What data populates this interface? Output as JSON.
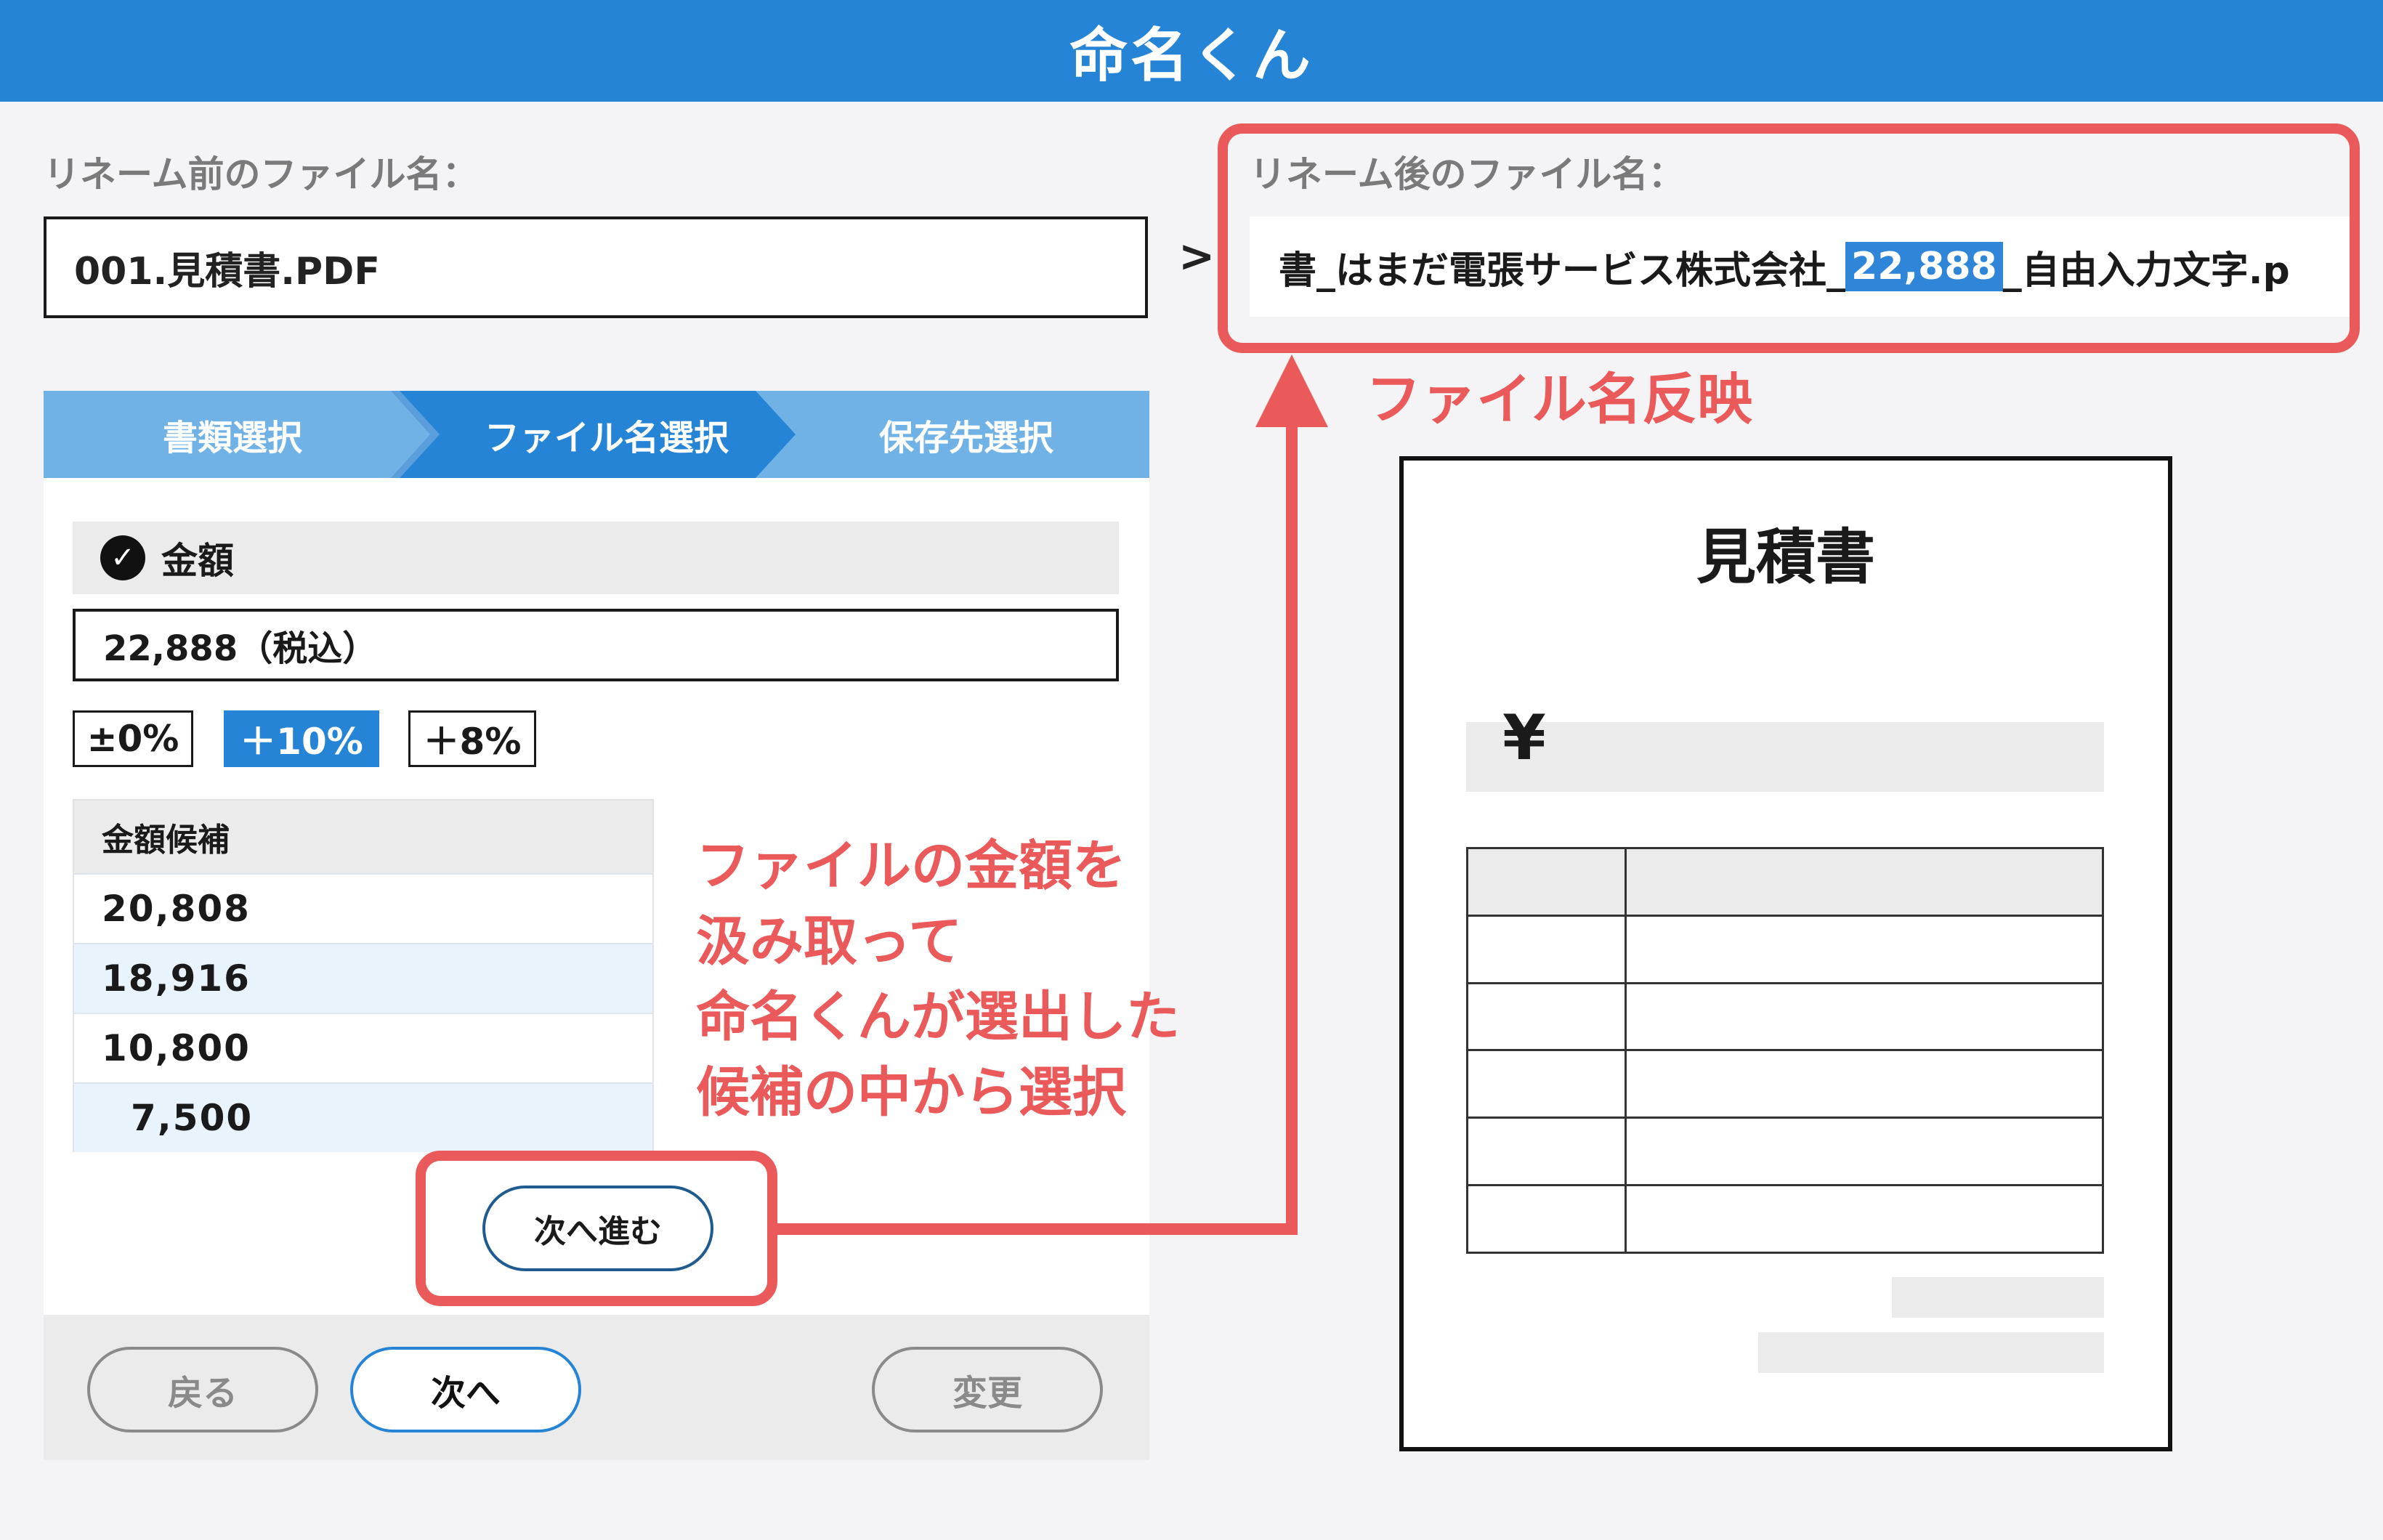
{
  "app": {
    "title": "命名くん"
  },
  "before": {
    "label": "リネーム前のファイル名：",
    "value": "001.見積書.PDF"
  },
  "arrow": ">",
  "after": {
    "label": "リネーム後のファイル名：",
    "prefix": "書_はまだ電張サービス株式会社_",
    "highlight": "22,888",
    "suffix": "_自由入力文字.p"
  },
  "steps": [
    "書類選択",
    "ファイル名選択",
    "保存先選択"
  ],
  "amount": {
    "heading": "金額",
    "value": "22,888（税込）",
    "tax_buttons": [
      "±0%",
      "＋10%",
      "＋8%"
    ],
    "candidates_heading": "金額候補",
    "candidates": [
      "20,808",
      "18,916",
      "10,800",
      "7,500"
    ]
  },
  "next_step_button": "次へ進む",
  "footer": {
    "back": "戻る",
    "next": "次へ",
    "change": "変更"
  },
  "annotations": {
    "reflect": "ファイル名反映",
    "extract_lines": [
      "ファイルの金額を",
      "汲み取って",
      "命名くんが選出した",
      "候補の中から選択"
    ]
  },
  "document": {
    "title": "見積書",
    "currency": "¥"
  },
  "colors": {
    "header": "#2684d6",
    "highlight": "#ea5a5a",
    "step_active": "#2684d6",
    "step_inactive": "#71b2e6"
  }
}
